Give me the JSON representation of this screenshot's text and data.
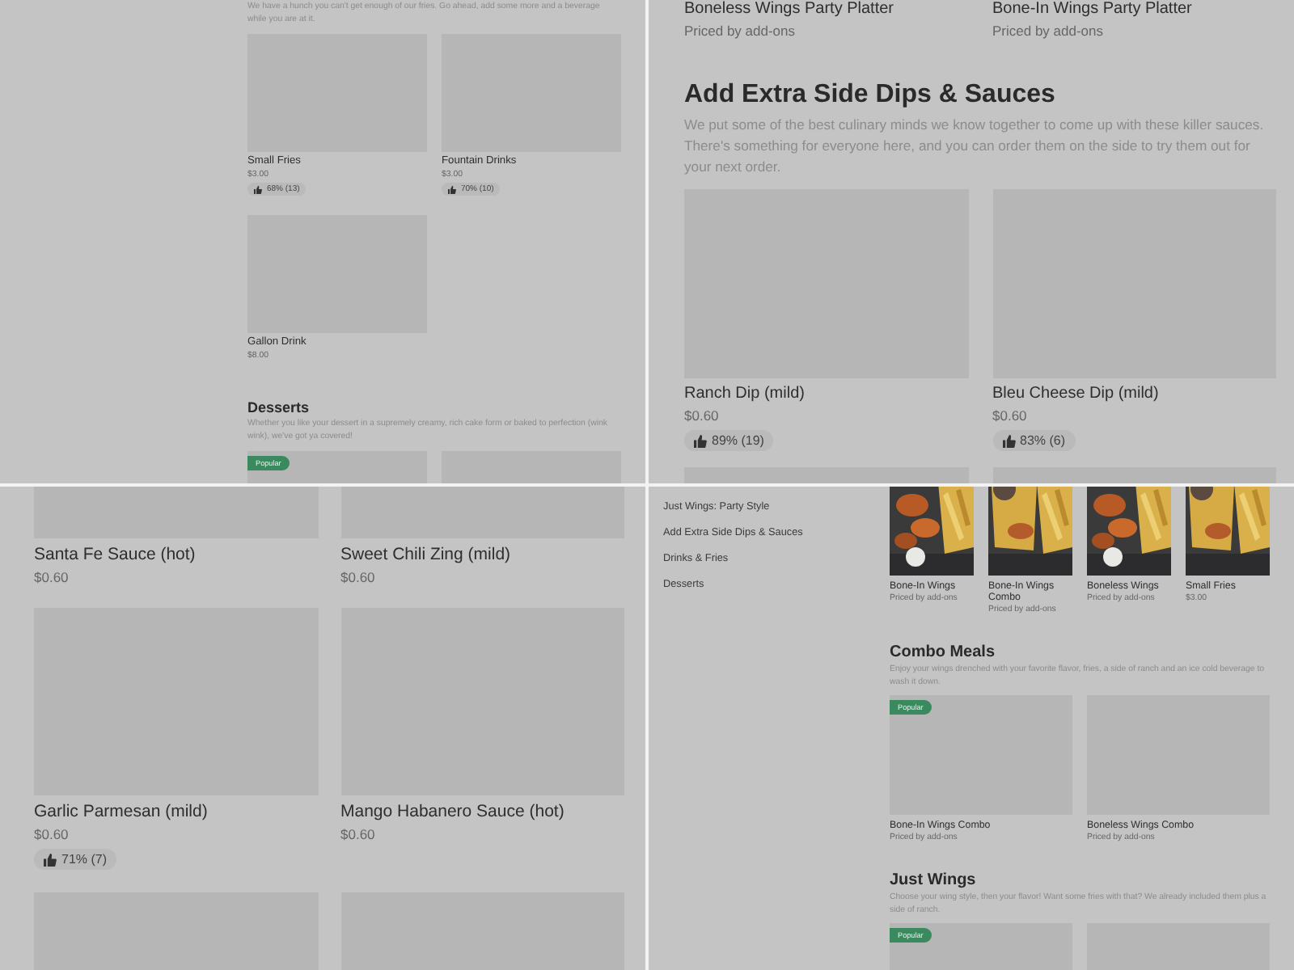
{
  "panels": [
    {
      "sections": [
        {
          "description": "We have a hunch you can't get enough of our fries. Go ahead, add some more and a beverage while you are at it.",
          "items": [
            {
              "kind": "placeholder",
              "name": "Small Fries",
              "price": "$3.00",
              "rating": "68% (13)",
              "popular": false
            },
            {
              "kind": "placeholder",
              "name": "Fountain Drinks",
              "price": "$3.00",
              "rating": "70% (10)",
              "popular": false
            },
            {
              "kind": "placeholder",
              "name": "Gallon Drink",
              "price": "$8.00",
              "popular": false
            }
          ]
        },
        {
          "heading": "Desserts",
          "description": "Whether you like your dessert in a supremely creamy, rich cake form or baked to perfection (wink wink), we've got ya covered!",
          "items": [
            {
              "kind": "placeholder",
              "popular": true,
              "badge": "Popular"
            },
            {
              "kind": "placeholder",
              "popular": false
            }
          ]
        }
      ]
    },
    {
      "sections": [
        {
          "items": [
            {
              "kind": "none",
              "name": "Boneless Wings Party Platter",
              "price": "Priced by add-ons",
              "popular": false
            },
            {
              "kind": "none",
              "name": "Bone-In Wings Party Platter",
              "price": "Priced by add-ons",
              "popular": false
            }
          ]
        },
        {
          "heading": "Add Extra Side Dips & Sauces",
          "description": "We put some of the best culinary minds we know together to come up with these killer sauces. There's something for everyone here, and you can order them on the side to try them out for your next order.",
          "items": [
            {
              "kind": "placeholder",
              "name": "Ranch Dip (mild)",
              "price": "$0.60",
              "rating": "89% (19)",
              "popular": false
            },
            {
              "kind": "placeholder",
              "name": "Bleu Cheese Dip (mild)",
              "price": "$0.60",
              "rating": "83% (6)",
              "popular": false
            },
            {
              "kind": "placeholder",
              "popular": false
            },
            {
              "kind": "placeholder",
              "popular": false
            }
          ]
        }
      ]
    },
    {
      "sections": [
        {
          "items": [
            {
              "kind": "placeholder",
              "name": "Santa Fe Sauce (hot)",
              "price": "$0.60",
              "popular": false
            },
            {
              "kind": "placeholder",
              "name": "Sweet Chili Zing (mild)",
              "price": "$0.60",
              "popular": false
            },
            {
              "kind": "placeholder",
              "name": "Garlic Parmesan (mild)",
              "price": "$0.60",
              "rating": "71% (7)",
              "popular": false
            },
            {
              "kind": "placeholder",
              "name": "Mango Habanero Sauce (hot)",
              "price": "$0.60",
              "popular": false
            },
            {
              "kind": "placeholder",
              "popular": false
            },
            {
              "kind": "placeholder",
              "popular": false
            }
          ]
        }
      ]
    },
    {
      "sidebar": [
        {
          "label": "Just Wings: Party Style"
        },
        {
          "label": "Add Extra Side Dips & Sauces"
        },
        {
          "label": "Drinks & Fries"
        },
        {
          "label": "Desserts"
        }
      ],
      "sections": [
        {
          "items": [
            {
              "kind": "picture",
              "name": "Bone-In Wings",
              "price": "Priced by add-ons",
              "popular": false
            },
            {
              "kind": "picture",
              "name": "Bone-In Wings Combo",
              "price": "Priced by add-ons",
              "popular": false
            },
            {
              "kind": "picture",
              "name": "Boneless Wings",
              "price": "Priced by add-ons",
              "popular": false
            },
            {
              "kind": "picture",
              "name": "Small Fries",
              "price": "$3.00",
              "popular": false
            }
          ]
        },
        {
          "heading": "Combo Meals",
          "description": "Enjoy your wings drenched with your favorite flavor, fries, a side of ranch and an ice cold beverage to wash it down.",
          "items": [
            {
              "kind": "placeholder",
              "name": "Bone-In Wings Combo",
              "price": "Priced by add-ons",
              "popular": true,
              "badge": "Popular"
            },
            {
              "kind": "placeholder",
              "name": "Boneless Wings Combo",
              "price": "Priced by add-ons",
              "popular": false
            }
          ]
        },
        {
          "heading": "Just Wings",
          "description": "Choose your wing style, then your flavor! Want some fries with that? We already included them plus a side of ranch.",
          "items": [
            {
              "kind": "placeholder",
              "popular": true,
              "badge": "Popular"
            },
            {
              "kind": "placeholder",
              "popular": false
            }
          ]
        }
      ]
    }
  ]
}
